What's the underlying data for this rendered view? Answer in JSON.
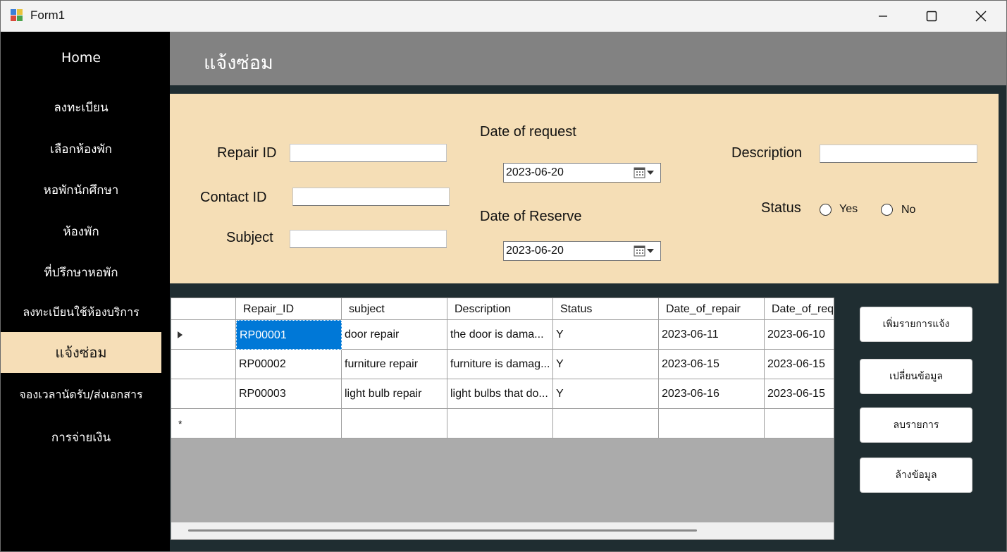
{
  "window": {
    "title": "Form1"
  },
  "sidebar": {
    "items": [
      {
        "label": "Home"
      },
      {
        "label": "ลงทะเบียน"
      },
      {
        "label": "เลือกห้องพัก"
      },
      {
        "label": "หอพักนักศึกษา"
      },
      {
        "label": "ห้องพัก"
      },
      {
        "label": "ที่ปรึกษาหอพัก"
      },
      {
        "label": "ลงทะเบียนใช้ห้องบริการ"
      },
      {
        "label": "แจ้งซ่อม"
      },
      {
        "label": "จองเวลานัดรับ/ส่งเอกสาร"
      },
      {
        "label": "การจ่ายเงิน"
      }
    ],
    "active_index": 7
  },
  "header": {
    "title": "แจ้งซ่อม"
  },
  "form": {
    "repair_id_label": "Repair ID",
    "repair_id_value": "",
    "contact_id_label": "Contact ID",
    "contact_id_value": "",
    "subject_label": "Subject",
    "subject_value": "",
    "date_request_label": "Date of request",
    "date_request_value": "2023-06-20",
    "date_reserve_label": "Date of Reserve",
    "date_reserve_value": "2023-06-20",
    "description_label": "Description",
    "description_value": "",
    "status_label": "Status",
    "status_yes": "Yes",
    "status_no": "No"
  },
  "grid": {
    "columns": [
      "Repair_ID",
      "subject",
      "Description",
      "Status",
      "Date_of_repair",
      "Date_of_req"
    ],
    "rows": [
      [
        "RP00001",
        "door repair",
        "the door is dama...",
        "Y",
        "2023-06-11",
        "2023-06-10"
      ],
      [
        "RP00002",
        "furniture repair",
        "furniture is damag...",
        "Y",
        "2023-06-15",
        "2023-06-15"
      ],
      [
        "RP00003",
        "light bulb repair",
        "light bulbs that do...",
        "Y",
        "2023-06-16",
        "2023-06-15"
      ]
    ],
    "new_row_marker": "*"
  },
  "actions": {
    "add": "เพิ่มรายการแจ้ง",
    "edit": "เปลี่ยนข้อมูล",
    "delete": "ลบรายการ",
    "clear": "ล้างข้อมูล"
  },
  "colors": {
    "sidebar_bg": "#000000",
    "active_nav_bg": "#f6deb7",
    "form_bg": "#f5deb6",
    "header_bg": "#828282",
    "content_bg": "#1f2d31",
    "selected_cell": "#0078d7"
  }
}
